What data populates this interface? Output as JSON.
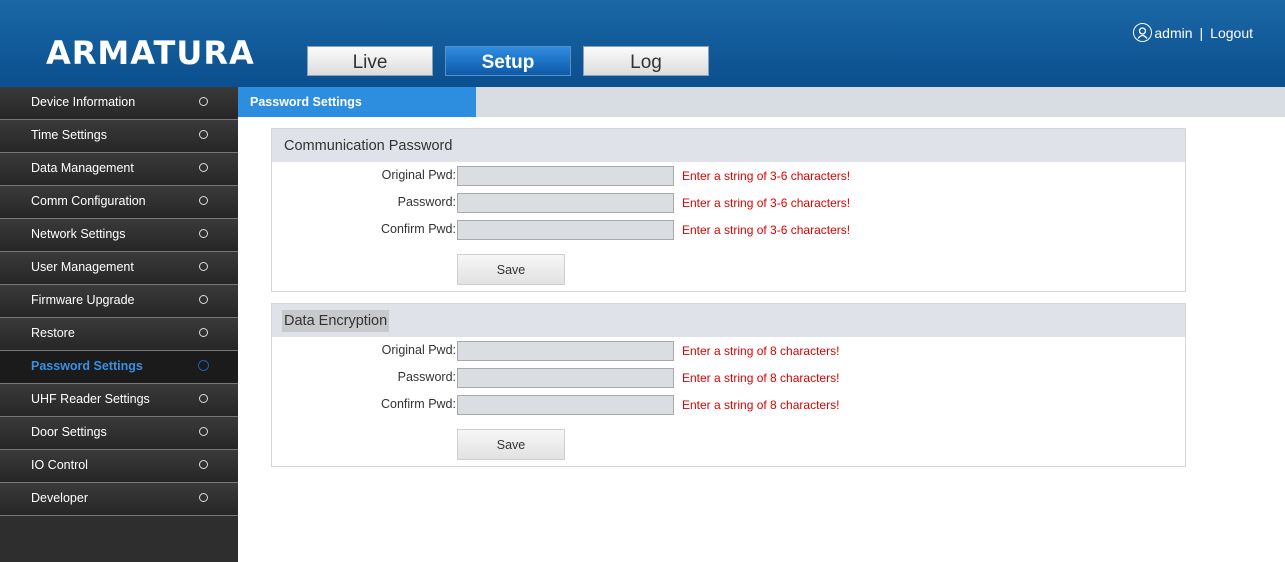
{
  "header": {
    "logo": "ARMATURA",
    "tabs": [
      {
        "label": "Live"
      },
      {
        "label": "Setup"
      },
      {
        "label": "Log"
      }
    ],
    "user": "admin",
    "separator": "|",
    "logout": "Logout",
    "accent": "#0b4f8e"
  },
  "sidebar": {
    "items": [
      {
        "label": "Device Information"
      },
      {
        "label": "Time Settings"
      },
      {
        "label": "Data Management"
      },
      {
        "label": "Comm Configuration"
      },
      {
        "label": "Network Settings"
      },
      {
        "label": "User Management"
      },
      {
        "label": "Firmware Upgrade"
      },
      {
        "label": "Restore"
      },
      {
        "label": "Password Settings"
      },
      {
        "label": "UHF Reader Settings"
      },
      {
        "label": "Door Settings"
      },
      {
        "label": "IO Control"
      },
      {
        "label": "Developer"
      }
    ],
    "active_index": 8
  },
  "content": {
    "tab_label": "Password Settings",
    "communication": {
      "title": "Communication Password",
      "original_label": "Original Pwd:",
      "password_label": "Password:",
      "confirm_label": "Confirm Pwd:",
      "original_hint": "Enter a string of 3-6 characters!",
      "password_hint": "Enter a string of 3-6 characters!",
      "confirm_hint": "Enter a string of 3-6 characters!",
      "original_value": "",
      "password_value": "",
      "confirm_value": "",
      "save_label": "Save"
    },
    "encryption": {
      "title": "Data Encryption",
      "original_label": "Original Pwd:",
      "password_label": "Password:",
      "confirm_label": "Confirm Pwd:",
      "original_hint": "Enter a string of 8 characters!",
      "password_hint": "Enter a string of 8 characters!",
      "confirm_hint": "Enter a string of 8 characters!",
      "original_value": "",
      "password_value": "",
      "confirm_value": "",
      "save_label": "Save"
    },
    "hint_color": "#e00000"
  }
}
